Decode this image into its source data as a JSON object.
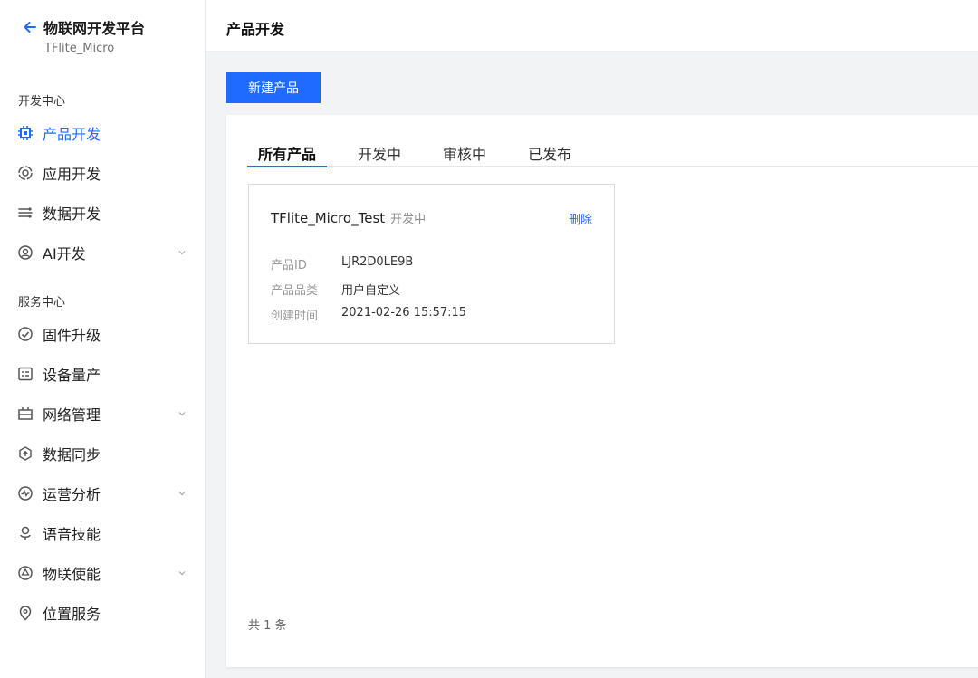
{
  "sidebar": {
    "brand_title": "物联网开发平台",
    "brand_sub": "TFlite_Micro",
    "dev_section": "开发中心",
    "service_section": "服务中心",
    "dev_items": [
      {
        "label": "产品开发",
        "icon": "chip-icon",
        "active": true
      },
      {
        "label": "应用开发",
        "icon": "app-ring-icon",
        "active": false
      },
      {
        "label": "数据开发",
        "icon": "data-flow-icon",
        "active": false
      },
      {
        "label": "AI开发",
        "icon": "ai-icon",
        "active": false,
        "expandable": true
      }
    ],
    "service_items": [
      {
        "label": "固件升级",
        "icon": "firmware-icon",
        "active": false
      },
      {
        "label": "设备量产",
        "icon": "production-icon",
        "active": false
      },
      {
        "label": "网络管理",
        "icon": "network-icon",
        "active": false,
        "expandable": true
      },
      {
        "label": "数据同步",
        "icon": "sync-icon",
        "active": false
      },
      {
        "label": "运营分析",
        "icon": "analytics-icon",
        "active": false,
        "expandable": true
      },
      {
        "label": "语音技能",
        "icon": "voice-icon",
        "active": false
      },
      {
        "label": "物联使能",
        "icon": "enable-icon",
        "active": false,
        "expandable": true
      },
      {
        "label": "位置服务",
        "icon": "location-icon",
        "active": false
      }
    ]
  },
  "header": {
    "title": "产品开发"
  },
  "toolbar": {
    "new_label": "新建产品"
  },
  "tabs": [
    {
      "label": "所有产品",
      "active": true
    },
    {
      "label": "开发中",
      "active": false
    },
    {
      "label": "审核中",
      "active": false
    },
    {
      "label": "已发布",
      "active": false
    }
  ],
  "product": {
    "name": "TFlite_Micro_Test",
    "status": "开发中",
    "delete_label": "删除",
    "id_key": "产品ID",
    "id_val": "LJR2D0LE9B",
    "category_key": "产品品类",
    "category_val": "用户自定义",
    "created_key": "创建时间",
    "created_val": "2021-02-26 15:57:15"
  },
  "pagination": {
    "total_text": "共 1 条"
  },
  "colors": {
    "accent": "#1f6bff",
    "bg": "#f2f3f5"
  }
}
